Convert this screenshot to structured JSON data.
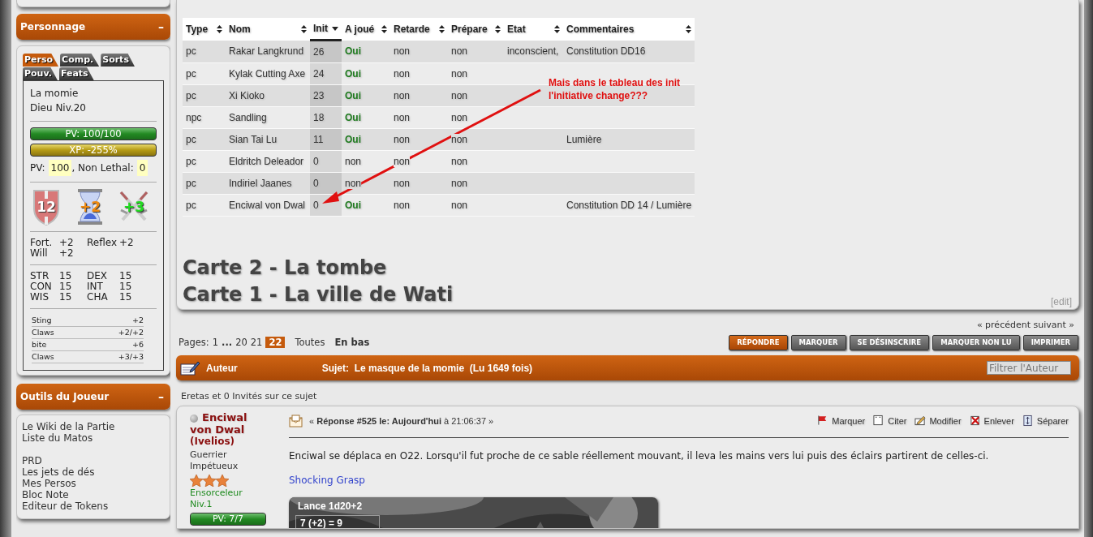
{
  "personnage": {
    "title": "Personnage",
    "collapse": "–",
    "tabs": [
      {
        "label": "Perso",
        "selected": true
      },
      {
        "label": "Comp.",
        "selected": false
      },
      {
        "label": "Sorts",
        "selected": false
      },
      {
        "label": "Pouv.",
        "selected": false
      },
      {
        "label": "Feats",
        "selected": false
      }
    ],
    "name": "La momie",
    "rank": "Dieu Niv.20",
    "bars": [
      {
        "kind": "hp",
        "label": "PV: 100/100",
        "level": 1
      },
      {
        "kind": "xp",
        "label": "XP: -255%",
        "level": 1
      }
    ],
    "pv_label": "PV:",
    "pv": "100",
    "nl_label": ", Non Lethal:",
    "nl": "0",
    "badges": [
      {
        "kind": "shield",
        "value": "12"
      },
      {
        "kind": "hourglass",
        "value": "+2"
      },
      {
        "kind": "swords",
        "value": "+3"
      }
    ],
    "saves": [
      {
        "label": "Fort.",
        "value": "+2"
      },
      {
        "label": "Reflex",
        "value": "+2"
      },
      {
        "label": "Will",
        "value": "+2"
      }
    ],
    "abilities": [
      {
        "label": "STR",
        "value": "15"
      },
      {
        "label": "DEX",
        "value": "15"
      },
      {
        "label": "CON",
        "value": "15"
      },
      {
        "label": "INT",
        "value": "15"
      },
      {
        "label": "WIS",
        "value": "15"
      },
      {
        "label": "CHA",
        "value": "15"
      }
    ],
    "attacks": [
      {
        "name": "Sting",
        "bonus": "+2"
      },
      {
        "name": "Claws",
        "bonus": "+2/+2"
      },
      {
        "name": "bite",
        "bonus": "+6"
      },
      {
        "name": "Claws",
        "bonus": "+3/+3"
      }
    ]
  },
  "outils": {
    "title": "Outils du Joueur",
    "collapse": "–",
    "link_groups": [
      {
        "links": [
          "Le Wiki de la Partie",
          "Liste du Matos"
        ]
      },
      {
        "links": [
          "PRD",
          "Les jets de dés",
          "Mes Persos",
          "Bloc Note",
          "Editeur de Tokens"
        ]
      }
    ]
  },
  "init_table": {
    "columns": [
      {
        "label": "Type",
        "sorted": false
      },
      {
        "label": "Nom",
        "sorted": false
      },
      {
        "label": "Init",
        "sorted": true
      },
      {
        "label": "A joué",
        "sorted": false
      },
      {
        "label": "Retarde",
        "sorted": false
      },
      {
        "label": "Prépare",
        "sorted": false
      },
      {
        "label": "Etat",
        "sorted": false
      },
      {
        "label": "Commentaires",
        "sorted": false
      }
    ],
    "rows": [
      {
        "type": "pc",
        "nom": "Rakar Langkrund",
        "init": "26",
        "a_joue": "Oui",
        "played": true,
        "retarde": "non",
        "prepare": "non",
        "etat": "inconscient,",
        "commentaires": "Constitution DD16"
      },
      {
        "type": "pc",
        "nom": "Kylak Cutting Axe",
        "init": "24",
        "a_joue": "Oui",
        "played": true,
        "retarde": "non",
        "prepare": "non"
      },
      {
        "type": "pc",
        "nom": "Xi Kioko",
        "init": "23",
        "a_joue": "Oui",
        "played": true,
        "retarde": "non",
        "prepare": "non"
      },
      {
        "type": "npc",
        "nom": "Sandling",
        "init": "18",
        "a_joue": "Oui",
        "played": true,
        "retarde": "non",
        "prepare": "non"
      },
      {
        "type": "pc",
        "nom": "Sian Tai Lu",
        "init": "11",
        "a_joue": "Oui",
        "played": true,
        "retarde": "non",
        "prepare": "non",
        "commentaires": "Lumière"
      },
      {
        "type": "pc",
        "nom": "Eldritch Deleador",
        "init": "0",
        "a_joue": "non",
        "played": false,
        "retarde": "non",
        "prepare": "non"
      },
      {
        "type": "pc",
        "nom": "Indiriel Jaanes",
        "init": "0",
        "a_joue": "non",
        "played": false,
        "retarde": "non",
        "prepare": "non"
      },
      {
        "type": "pc",
        "nom": "Enciwal von Dwal",
        "init": "0",
        "a_joue": "Oui",
        "played": true,
        "retarde": "non",
        "prepare": "non",
        "commentaires": "Constitution DD 14 / Lumière"
      }
    ]
  },
  "annotation": {
    "lines": [
      "Mais dans le tableau des init",
      "l'initiative change???"
    ]
  },
  "maps": [
    "Carte 2 - La tombe",
    "Carte 1 - La ville de Wati"
  ],
  "edit_link": "[edit]",
  "nav": "« précédent suivant »",
  "pagination": {
    "label": "Pages:",
    "items": [
      {
        "kind": "page",
        "label": "1",
        "selected": false
      },
      {
        "kind": "gap",
        "label": "...",
        "selected": false
      },
      {
        "kind": "page",
        "label": "20",
        "selected": false
      },
      {
        "kind": "page",
        "label": "21",
        "selected": false
      },
      {
        "kind": "page",
        "label": "22",
        "selected": true
      },
      {
        "kind": "page",
        "label": "Toutes",
        "selected": false
      },
      {
        "kind": "bottom",
        "label": "En bas",
        "selected": false
      }
    ]
  },
  "buttons": [
    {
      "label": "RÉPONDRE",
      "primary": true
    },
    {
      "label": "MARQUER",
      "primary": false
    },
    {
      "label": "SE DÉSINSCRIRE",
      "primary": false
    },
    {
      "label": "MARQUER NON LU",
      "primary": false
    },
    {
      "label": "IMPRIMER",
      "primary": false
    }
  ],
  "topic_bar": {
    "author": "Auteur",
    "subject": "Sujet:  Le masque de la momie  (Lu 1649 fois)",
    "filter_placeholder": "Filtrer l'Auteur"
  },
  "viewers": "Eretas et 0 Invités sur ce sujet",
  "post": {
    "author": {
      "online": false,
      "name": "Enciwal von Dwal",
      "alias": "(Ivelios)",
      "titles": [
        "Guerrier",
        "Impétueux"
      ],
      "stars": 3,
      "class": "Ensorceleur",
      "level": "Niv.1",
      "hp": {
        "label": "PV: 7/7",
        "level": 1
      }
    },
    "header": "« **Réponse #525 le: Aujourd'hui** à 21:06:37 »",
    "actions": [
      {
        "kind": "flag",
        "label": "Marquer"
      },
      {
        "kind": "quote",
        "label": "Citer"
      },
      {
        "kind": "edit",
        "label": "Modifier"
      },
      {
        "kind": "delete",
        "label": "Enlever"
      },
      {
        "kind": "split",
        "label": "Séparer"
      }
    ],
    "body": "Enciwal se déplaca en O22. Lorsqu'il fut proche de ce sable réellement mouvant, il leva les mains vers lui puis des éclairs partirent de celles-ci.",
    "link": "Shocking Grasp",
    "roll": {
      "title": "Lance 1d20+2",
      "result": "7 (+2) = 9"
    }
  }
}
